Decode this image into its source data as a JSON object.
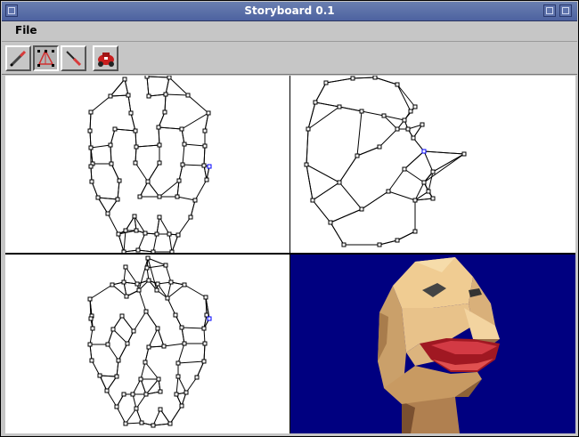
{
  "window": {
    "title": "Storyboard 0.1"
  },
  "menu": {
    "file_label": "File"
  },
  "toolbar": {
    "tools": [
      {
        "icon": "pencil-icon",
        "active": false
      },
      {
        "icon": "mesh-select-icon",
        "active": true
      },
      {
        "icon": "knife-icon",
        "active": false
      },
      {
        "icon": "render-car-icon",
        "active": false
      }
    ]
  },
  "viewports": [
    "front-wireframe",
    "side-wireframe",
    "top-wireframe",
    "shaded-render"
  ],
  "colors": {
    "title_bar": "#5066a3",
    "render_background": "#000080",
    "face_skin": "#e8c28a",
    "mouth": "#c8323a"
  }
}
